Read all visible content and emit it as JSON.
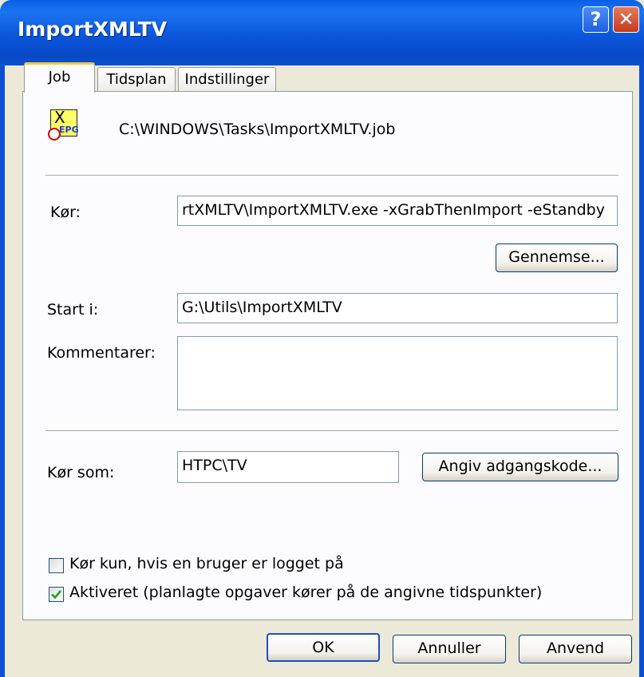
{
  "window": {
    "title": "ImportXMLTV",
    "help_glyph": "?",
    "close_glyph": "✕"
  },
  "tabs": [
    {
      "label": "Job",
      "active": true
    },
    {
      "label": "Tidsplan",
      "active": false
    },
    {
      "label": "Indstillinger",
      "active": false
    }
  ],
  "job": {
    "file_path": "C:\\WINDOWS\\Tasks\\ImportXMLTV.job",
    "icon": "xepg-scheduled-task-icon",
    "run_label": "Kør:",
    "run_value": "rtXMLTV\\ImportXMLTV.exe -xGrabThenImport -eStandby",
    "browse_label": "Gennemse...",
    "start_in_label": "Start i:",
    "start_in_value": "G:\\Utils\\ImportXMLTV",
    "comments_label": "Kommentarer:",
    "comments_value": "",
    "run_as_label": "Kør som:",
    "run_as_value": "HTPC\\TV",
    "set_password_label": "Angiv adgangskode...",
    "only_logged_on_label": "Kør kun, hvis en bruger er logget på",
    "only_logged_on_checked": false,
    "enabled_label": "Aktiveret (planlagte opgaver kører på de angivne tidspunkter)",
    "enabled_checked": true
  },
  "buttons": {
    "ok": "OK",
    "cancel": "Annuller",
    "apply": "Anvend"
  },
  "colors": {
    "titlebar": "#0b56db",
    "dialog_bg": "#ece9d8",
    "active_tab_accent": "#ffc83c",
    "check_mark": "#21a121"
  }
}
